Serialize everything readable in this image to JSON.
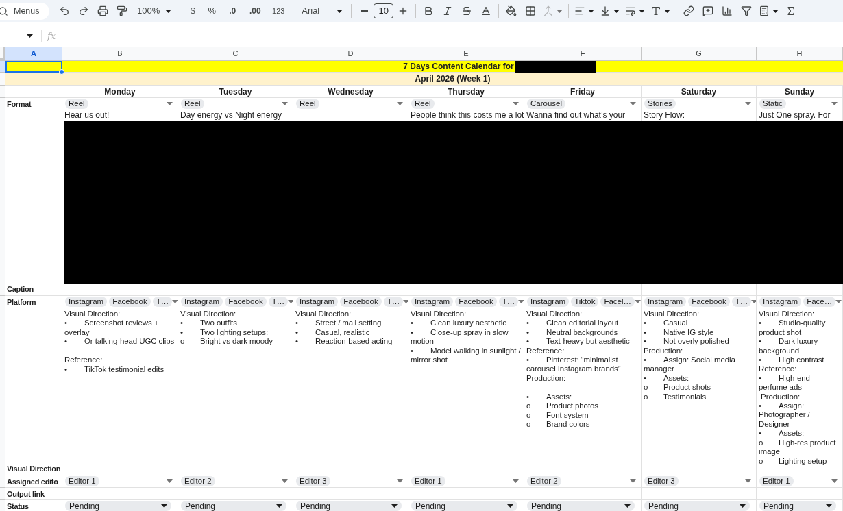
{
  "toolbar": {
    "search_placeholder": "Menus",
    "zoom": "100%",
    "currency": "$",
    "percent": "%",
    "decrease_decimals": ".0",
    "increase_decimals": ".00",
    "number_format": "123",
    "font": "Arial",
    "font_size": "10"
  },
  "formula_bar": {
    "fx": "fx"
  },
  "columns": [
    {
      "label": "A",
      "selected": true
    },
    {
      "label": "B",
      "selected": false
    },
    {
      "label": "C",
      "selected": false
    },
    {
      "label": "D",
      "selected": false
    },
    {
      "label": "E",
      "selected": false
    },
    {
      "label": "F",
      "selected": false
    },
    {
      "label": "G",
      "selected": false
    },
    {
      "label": "H",
      "selected": false
    }
  ],
  "title": "7 Days Content Calendar for",
  "subtitle": "April 2026 (Week 1)",
  "row_labels": {
    "format": "Format",
    "caption": "Caption",
    "platform": "Platform",
    "visual": "Visual Direction",
    "editor": "Assigned edito",
    "output": "Output link",
    "status": "Status"
  },
  "days": [
    {
      "name": "Monday",
      "format": "Reel",
      "caption": "Hear us out!",
      "platforms": [
        "Instagram",
        "Facebook",
        "T…"
      ],
      "editor": "Editor 1",
      "status": "Pending",
      "visual": [
        {
          "text": "Visual Direction:"
        },
        {
          "marker": "•",
          "text": "Screenshot reviews + overlay"
        },
        {
          "marker": "•",
          "text": "Or talking-head UGC clips"
        },
        {
          "kind": "spacer"
        },
        {
          "text": "Reference:"
        },
        {
          "marker": "•",
          "text": "TikTok testimonial edits"
        }
      ]
    },
    {
      "name": "Tuesday",
      "format": "Reel",
      "caption": "Day energy vs Night energy",
      "platforms": [
        "Instagram",
        "Facebook",
        "T…"
      ],
      "editor": "Editor 2",
      "status": "Pending",
      "visual": [
        {
          "text": "Visual Direction:"
        },
        {
          "marker": "•",
          "text": "Two outfits"
        },
        {
          "marker": "•",
          "text": "Two lighting setups:"
        },
        {
          "marker": "o",
          "text": "Bright vs dark moody"
        }
      ]
    },
    {
      "name": "Wednesday",
      "format": "Reel",
      "platforms": [
        "Instagram",
        "Facebook",
        "T…"
      ],
      "editor": "Editor 3",
      "status": "Pending",
      "visual": [
        {
          "text": "Visual Direction:"
        },
        {
          "marker": "•",
          "text": "Street / mall setting"
        },
        {
          "marker": "•",
          "text": "Casual, realistic"
        },
        {
          "marker": "•",
          "text": "Reaction-based acting"
        }
      ]
    },
    {
      "name": "Thursday",
      "format": "Reel",
      "caption": "People think this costs me a lot",
      "platforms": [
        "Instagram",
        "Facebook",
        "T…"
      ],
      "editor": "Editor 1",
      "status": "Pending",
      "visual": [
        {
          "text": "Visual Direction:"
        },
        {
          "marker": "•",
          "text": "Clean luxury aesthetic"
        },
        {
          "marker": "•",
          "text": "Close-up spray in slow motion"
        },
        {
          "marker": "•",
          "text": "Model walking in sunlight / mirror shot"
        }
      ]
    },
    {
      "name": "Friday",
      "format": "Carousel",
      "caption": "Wanna find out what’s your",
      "platforms": [
        "Instagram",
        "Tiktok",
        "Facel…"
      ],
      "editor": "Editor 2",
      "status": "Pending",
      "visual": [
        {
          "text": "Visual Direction:"
        },
        {
          "marker": "•",
          "text": "Clean editorial layout"
        },
        {
          "marker": "•",
          "text": "Neutral backgrounds"
        },
        {
          "marker": "•",
          "text": "Text-heavy but aesthetic"
        },
        {
          "text": "Reference:"
        },
        {
          "marker": "•",
          "text": "Pinterest: “minimalist carousel Instagram brands”"
        },
        {
          "text": "Production:"
        },
        {
          "kind": "spacer"
        },
        {
          "marker": "•",
          "text": "Assets:"
        },
        {
          "marker": "o",
          "text": "Product photos"
        },
        {
          "marker": "o",
          "text": "Font system"
        },
        {
          "marker": "o",
          "text": "Brand colors"
        }
      ]
    },
    {
      "name": "Saturday",
      "format": "Stories",
      "caption": "Story Flow:",
      "platforms": [
        "Instagram",
        "Facebook",
        "T…"
      ],
      "editor": "Editor 3",
      "status": "Pending",
      "visual": [
        {
          "text": "Visual Direction:"
        },
        {
          "marker": "•",
          "text": "Casual"
        },
        {
          "marker": "•",
          "text": "Native IG style"
        },
        {
          "marker": "•",
          "text": "Not overly polished"
        },
        {
          "text": "Production:"
        },
        {
          "marker": "•",
          "text": "Assign: Social media manager"
        },
        {
          "marker": "•",
          "text": "Assets:"
        },
        {
          "marker": "o",
          "text": "Product shots"
        },
        {
          "marker": "o",
          "text": "Testimonials"
        }
      ]
    },
    {
      "name": "Sunday",
      "format": "Static",
      "caption": "Just One spray. For",
      "platforms": [
        "Instagram",
        "Face…"
      ],
      "editor": "Editor 1",
      "status": "Pending",
      "visual": [
        {
          "text": "Visual Direction:"
        },
        {
          "marker": "•",
          "text": "Studio-quality product shot"
        },
        {
          "marker": "•",
          "text": "Dark luxury background"
        },
        {
          "marker": "•",
          "text": "High contrast"
        },
        {
          "text": "Reference:"
        },
        {
          "marker": "•",
          "text": "High-end perfume ads"
        },
        {
          "text": " Production:"
        },
        {
          "marker": "•",
          "text": "Assign: Photographer / Designer"
        },
        {
          "marker": "•",
          "text": "Assets:"
        },
        {
          "marker": "o",
          "text": "High-res product image"
        },
        {
          "marker": "o",
          "text": "Lighting setup"
        }
      ]
    }
  ]
}
